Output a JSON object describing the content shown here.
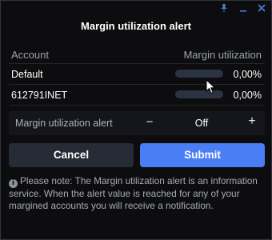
{
  "window": {
    "controls": {
      "pin_icon": "pin-icon",
      "minimize_icon": "minimize-icon",
      "close_icon": "close-icon"
    }
  },
  "dialog": {
    "title": "Margin utilization alert"
  },
  "table": {
    "headers": {
      "account": "Account",
      "utilization": "Margin utilization"
    },
    "rows": [
      {
        "account": "Default",
        "utilization_fraction": 0,
        "utilization_text": "0,00%"
      },
      {
        "account": "612791INET",
        "utilization_fraction": 0,
        "utilization_text": "0,00%"
      }
    ]
  },
  "alert": {
    "label": "Margin utilization alert",
    "value": "Off",
    "minus": "−",
    "plus": "+"
  },
  "buttons": {
    "cancel": "Cancel",
    "submit": "Submit"
  },
  "note": {
    "icon": "info-icon",
    "text": "Please note: The Margin utilization alert is an information service. When the alert value is reached for any of your margined accounts you will receive a notification."
  },
  "colors": {
    "background": "#0d0d0f",
    "accent": "#4a7ef5",
    "cancel_button": "#262b35",
    "bar_track": "#2b3240",
    "window_controls": "#4f7dd8"
  }
}
